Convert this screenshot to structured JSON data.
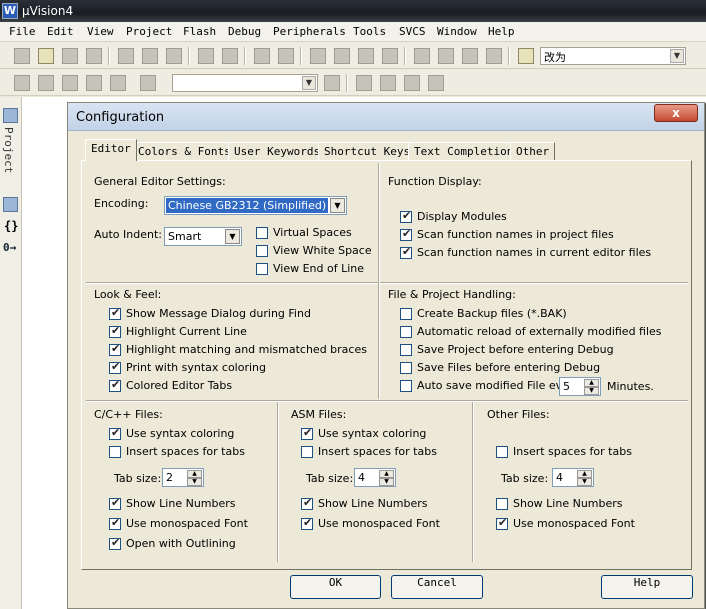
{
  "app": {
    "title": "µVision4",
    "icon": "uvision-logo-icon"
  },
  "menu": [
    "File",
    "Edit",
    "View",
    "Project",
    "Flash",
    "Debug",
    "Peripherals",
    "Tools",
    "SVCS",
    "Window",
    "Help"
  ],
  "toolbar": {
    "find_combo_value": "改为"
  },
  "sidebar": {
    "project_label": "Project"
  },
  "dialog": {
    "title": "Configuration",
    "close_label": "x",
    "tabs": [
      "Editor",
      "Colors & Fonts",
      "User Keywords",
      "Shortcut Keys",
      "Text Completion",
      "Other"
    ],
    "active_tab": "Editor",
    "general": {
      "heading": "General Editor Settings:",
      "encoding_label": "Encoding:",
      "encoding_value": "Chinese GB2312 (Simplified)",
      "autoindent_label": "Auto Indent:",
      "autoindent_value": "Smart",
      "checks": [
        {
          "label": "Virtual Spaces",
          "checked": false
        },
        {
          "label": "View White Space",
          "checked": false
        },
        {
          "label": "View End of Line",
          "checked": false
        }
      ]
    },
    "function_display": {
      "heading": "Function Display:",
      "checks": [
        {
          "label": "Display Modules",
          "checked": true
        },
        {
          "label": "Scan function names in project files",
          "checked": true
        },
        {
          "label": "Scan function names in current editor files",
          "checked": true
        }
      ]
    },
    "look_feel": {
      "heading": "Look & Feel:",
      "checks": [
        {
          "label": "Show Message Dialog during Find",
          "checked": true
        },
        {
          "label": "Highlight Current Line",
          "checked": true
        },
        {
          "label": "Highlight matching and mismatched braces",
          "checked": true
        },
        {
          "label": "Print with syntax coloring",
          "checked": true
        },
        {
          "label": "Colored Editor Tabs",
          "checked": true
        }
      ]
    },
    "file_project": {
      "heading": "File & Project Handling:",
      "checks": [
        {
          "label": "Create Backup files (*.BAK)",
          "checked": false
        },
        {
          "label": "Automatic reload of externally modified files",
          "checked": false
        },
        {
          "label": "Save Project before entering Debug",
          "checked": false
        },
        {
          "label": "Save Files before entering Debug",
          "checked": false
        },
        {
          "label": "Auto save modified File every",
          "checked": false
        }
      ],
      "autosave_value": "5",
      "autosave_unit": "Minutes."
    },
    "cpp": {
      "heading": "C/C++ Files:",
      "tab_size_label": "Tab size:",
      "tab_size": "2",
      "checks": [
        {
          "label": "Use syntax coloring",
          "checked": true
        },
        {
          "label": "Insert spaces for tabs",
          "checked": false
        },
        {
          "label": "Show Line Numbers",
          "checked": true
        },
        {
          "label": "Use monospaced Font",
          "checked": true
        },
        {
          "label": "Open with Outlining",
          "checked": true
        }
      ]
    },
    "asm": {
      "heading": "ASM Files:",
      "tab_size_label": "Tab size:",
      "tab_size": "4",
      "checks": [
        {
          "label": "Use syntax coloring",
          "checked": true
        },
        {
          "label": "Insert spaces for tabs",
          "checked": false
        },
        {
          "label": "Show Line Numbers",
          "checked": true
        },
        {
          "label": "Use monospaced Font",
          "checked": true
        }
      ]
    },
    "other": {
      "heading": "Other Files:",
      "tab_size_label": "Tab size:",
      "tab_size": "4",
      "checks": [
        {
          "label": "Insert spaces for tabs",
          "checked": false
        },
        {
          "label": "Show Line Numbers",
          "checked": false
        },
        {
          "label": "Use monospaced Font",
          "checked": true
        }
      ]
    },
    "buttons": {
      "ok": "OK",
      "cancel": "Cancel",
      "help": "Help"
    }
  }
}
